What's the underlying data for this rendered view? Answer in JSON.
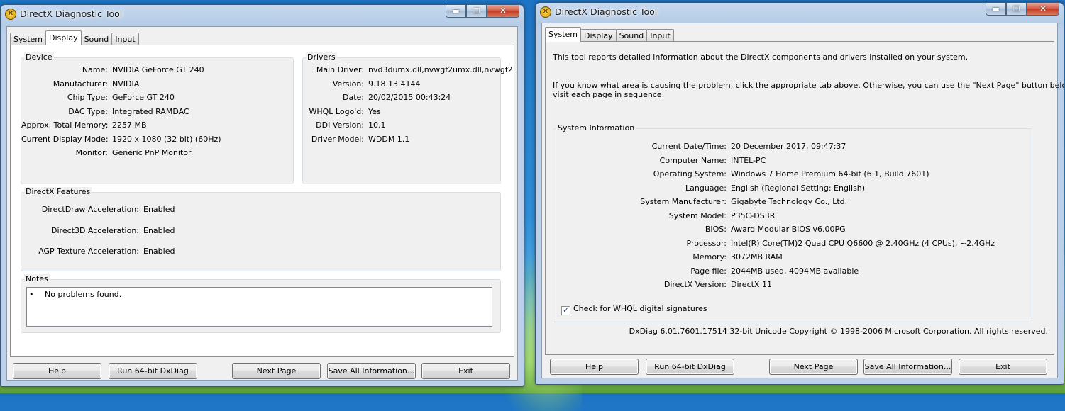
{
  "left_window": {
    "title": "DirectX Diagnostic Tool",
    "tabs": [
      "System",
      "Display",
      "Sound",
      "Input"
    ],
    "active_tab": "Display",
    "device": {
      "title": "Device",
      "rows": [
        {
          "k": "Name:",
          "v": "NVIDIA GeForce GT 240"
        },
        {
          "k": "Manufacturer:",
          "v": "NVIDIA"
        },
        {
          "k": "Chip Type:",
          "v": "GeForce GT 240"
        },
        {
          "k": "DAC Type:",
          "v": "Integrated RAMDAC"
        },
        {
          "k": "Approx. Total Memory:",
          "v": "2257 MB"
        },
        {
          "k": "Current Display Mode:",
          "v": "1920 x 1080 (32 bit) (60Hz)"
        },
        {
          "k": "Monitor:",
          "v": "Generic PnP Monitor"
        }
      ]
    },
    "drivers": {
      "title": "Drivers",
      "rows": [
        {
          "k": "Main Driver:",
          "v": "nvd3dumx.dll,nvwgf2umx.dll,nvwgf2"
        },
        {
          "k": "Version:",
          "v": "9.18.13.4144"
        },
        {
          "k": "Date:",
          "v": "20/02/2015 00:43:24"
        },
        {
          "k": "WHQL Logo'd:",
          "v": "Yes"
        },
        {
          "k": "DDI Version:",
          "v": "10.1"
        },
        {
          "k": "Driver Model:",
          "v": "WDDM 1.1"
        }
      ]
    },
    "features": {
      "title": "DirectX Features",
      "rows": [
        {
          "k": "DirectDraw Acceleration:",
          "v": "Enabled"
        },
        {
          "k": "Direct3D Acceleration:",
          "v": "Enabled"
        },
        {
          "k": "AGP Texture Acceleration:",
          "v": "Enabled"
        }
      ]
    },
    "notes": {
      "title": "Notes",
      "items": [
        "No problems found."
      ]
    },
    "buttons": {
      "help": "Help",
      "run64": "Run 64-bit DxDiag",
      "next": "Next Page",
      "save": "Save All Information...",
      "exit": "Exit"
    }
  },
  "right_window": {
    "title": "DirectX Diagnostic Tool",
    "tabs": [
      "System",
      "Display",
      "Sound",
      "Input"
    ],
    "active_tab": "System",
    "intro1": "This tool reports detailed information about the DirectX components and drivers installed on your system.",
    "intro2a": "If you know what area is causing the problem, click the appropriate tab above.  Otherwise, you can use the \"Next Page\" button below to",
    "intro2b": "visit each page in sequence.",
    "sysinfo": {
      "title": "System Information",
      "rows": [
        {
          "k": "Current Date/Time:",
          "v": "20 December 2017, 09:47:37"
        },
        {
          "k": "Computer Name:",
          "v": "INTEL-PC"
        },
        {
          "k": "Operating System:",
          "v": "Windows 7 Home Premium 64-bit (6.1, Build 7601)"
        },
        {
          "k": "Language:",
          "v": "English (Regional Setting: English)"
        },
        {
          "k": "System Manufacturer:",
          "v": "Gigabyte Technology Co., Ltd."
        },
        {
          "k": "System Model:",
          "v": "P35C-DS3R"
        },
        {
          "k": "BIOS:",
          "v": "Award Modular BIOS v6.00PG"
        },
        {
          "k": "Processor:",
          "v": "Intel(R) Core(TM)2 Quad CPU     Q6600  @ 2.40GHz (4 CPUs), ~2.4GHz"
        },
        {
          "k": "Memory:",
          "v": "3072MB RAM"
        },
        {
          "k": "Page file:",
          "v": "2044MB used, 4094MB available"
        },
        {
          "k": "DirectX Version:",
          "v": "DirectX 11"
        }
      ],
      "whql_label": "Check for WHQL digital signatures",
      "whql_checked": true
    },
    "footer": "DxDiag 6.01.7601.17514 32-bit Unicode  Copyright © 1998-2006 Microsoft Corporation.  All rights reserved.",
    "buttons": {
      "help": "Help",
      "run64": "Run 64-bit DxDiag",
      "next": "Next Page",
      "save": "Save All Information...",
      "exit": "Exit"
    }
  },
  "icons": {
    "app": "directx-icon",
    "minimize": "minimize-icon",
    "maximize": "maximize-icon",
    "close": "close-icon"
  },
  "glyphs": {
    "app": "✕",
    "min": "▬",
    "max": "☐",
    "close": "✕",
    "bullet": "•",
    "check": "✓"
  }
}
